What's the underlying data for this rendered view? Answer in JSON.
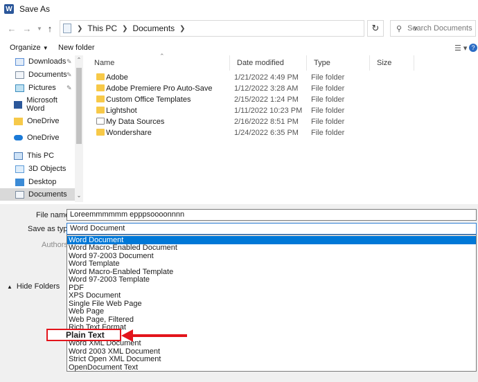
{
  "window": {
    "title": "Save As",
    "app_icon": "word-icon"
  },
  "nav": {
    "breadcrumb": [
      "This PC",
      "Documents"
    ],
    "search_placeholder": "Search Documents"
  },
  "toolbar": {
    "organize": "Organize",
    "new_folder": "New folder"
  },
  "sidebar": {
    "items": [
      {
        "label": "Downloads",
        "icon": "download-icon",
        "pinned": true
      },
      {
        "label": "Documents",
        "icon": "documents-icon",
        "pinned": true
      },
      {
        "label": "Pictures",
        "icon": "pictures-icon",
        "pinned": true
      },
      {
        "label": "Microsoft Word",
        "icon": "word-icon"
      },
      {
        "label": "OneDrive",
        "icon": "folder-icon"
      },
      {
        "label": "OneDrive",
        "icon": "onedrive-cloud-icon"
      },
      {
        "label": "This PC",
        "icon": "pc-icon"
      },
      {
        "label": "3D Objects",
        "icon": "3d-objects-icon"
      },
      {
        "label": "Desktop",
        "icon": "desktop-icon"
      },
      {
        "label": "Documents",
        "icon": "documents-icon",
        "selected": true
      }
    ]
  },
  "columns": {
    "name": "Name",
    "date": "Date modified",
    "type": "Type",
    "size": "Size"
  },
  "files": [
    {
      "name": "Adobe",
      "date": "1/21/2022 4:49 PM",
      "type": "File folder"
    },
    {
      "name": "Adobe Premiere Pro Auto-Save",
      "date": "1/12/2022 3:28 AM",
      "type": "File folder"
    },
    {
      "name": "Custom Office Templates",
      "date": "2/15/2022 1:24 PM",
      "type": "File folder"
    },
    {
      "name": "Lightshot",
      "date": "1/11/2022 10:23 PM",
      "type": "File folder"
    },
    {
      "name": "My Data Sources",
      "date": "2/16/2022 8:51 PM",
      "type": "File folder"
    },
    {
      "name": "Wondershare",
      "date": "1/24/2022 6:35 PM",
      "type": "File folder"
    }
  ],
  "form": {
    "file_name_label": "File name:",
    "file_name_value": "Loreemmmmmm epppsoooonnnn",
    "save_as_type_label": "Save as type:",
    "save_as_type_value": "Word Document",
    "authors_label": "Authors:",
    "hide_folders": "Hide Folders"
  },
  "type_options": [
    "Word Document",
    "Word Macro-Enabled Document",
    "Word 97-2003 Document",
    "Word Template",
    "Word Macro-Enabled Template",
    "Word 97-2003 Template",
    "PDF",
    "XPS Document",
    "Single File Web Page",
    "Web Page",
    "Web Page, Filtered",
    "Rich Text Format",
    "Plain Text",
    "Word XML Document",
    "Word 2003 XML Document",
    "Strict Open XML Document",
    "OpenDocument Text"
  ],
  "annotation": {
    "highlight_text": "Plain Text",
    "color": "#e3141b"
  },
  "colors": {
    "accent": "#0078d7",
    "folder": "#f7c948"
  }
}
